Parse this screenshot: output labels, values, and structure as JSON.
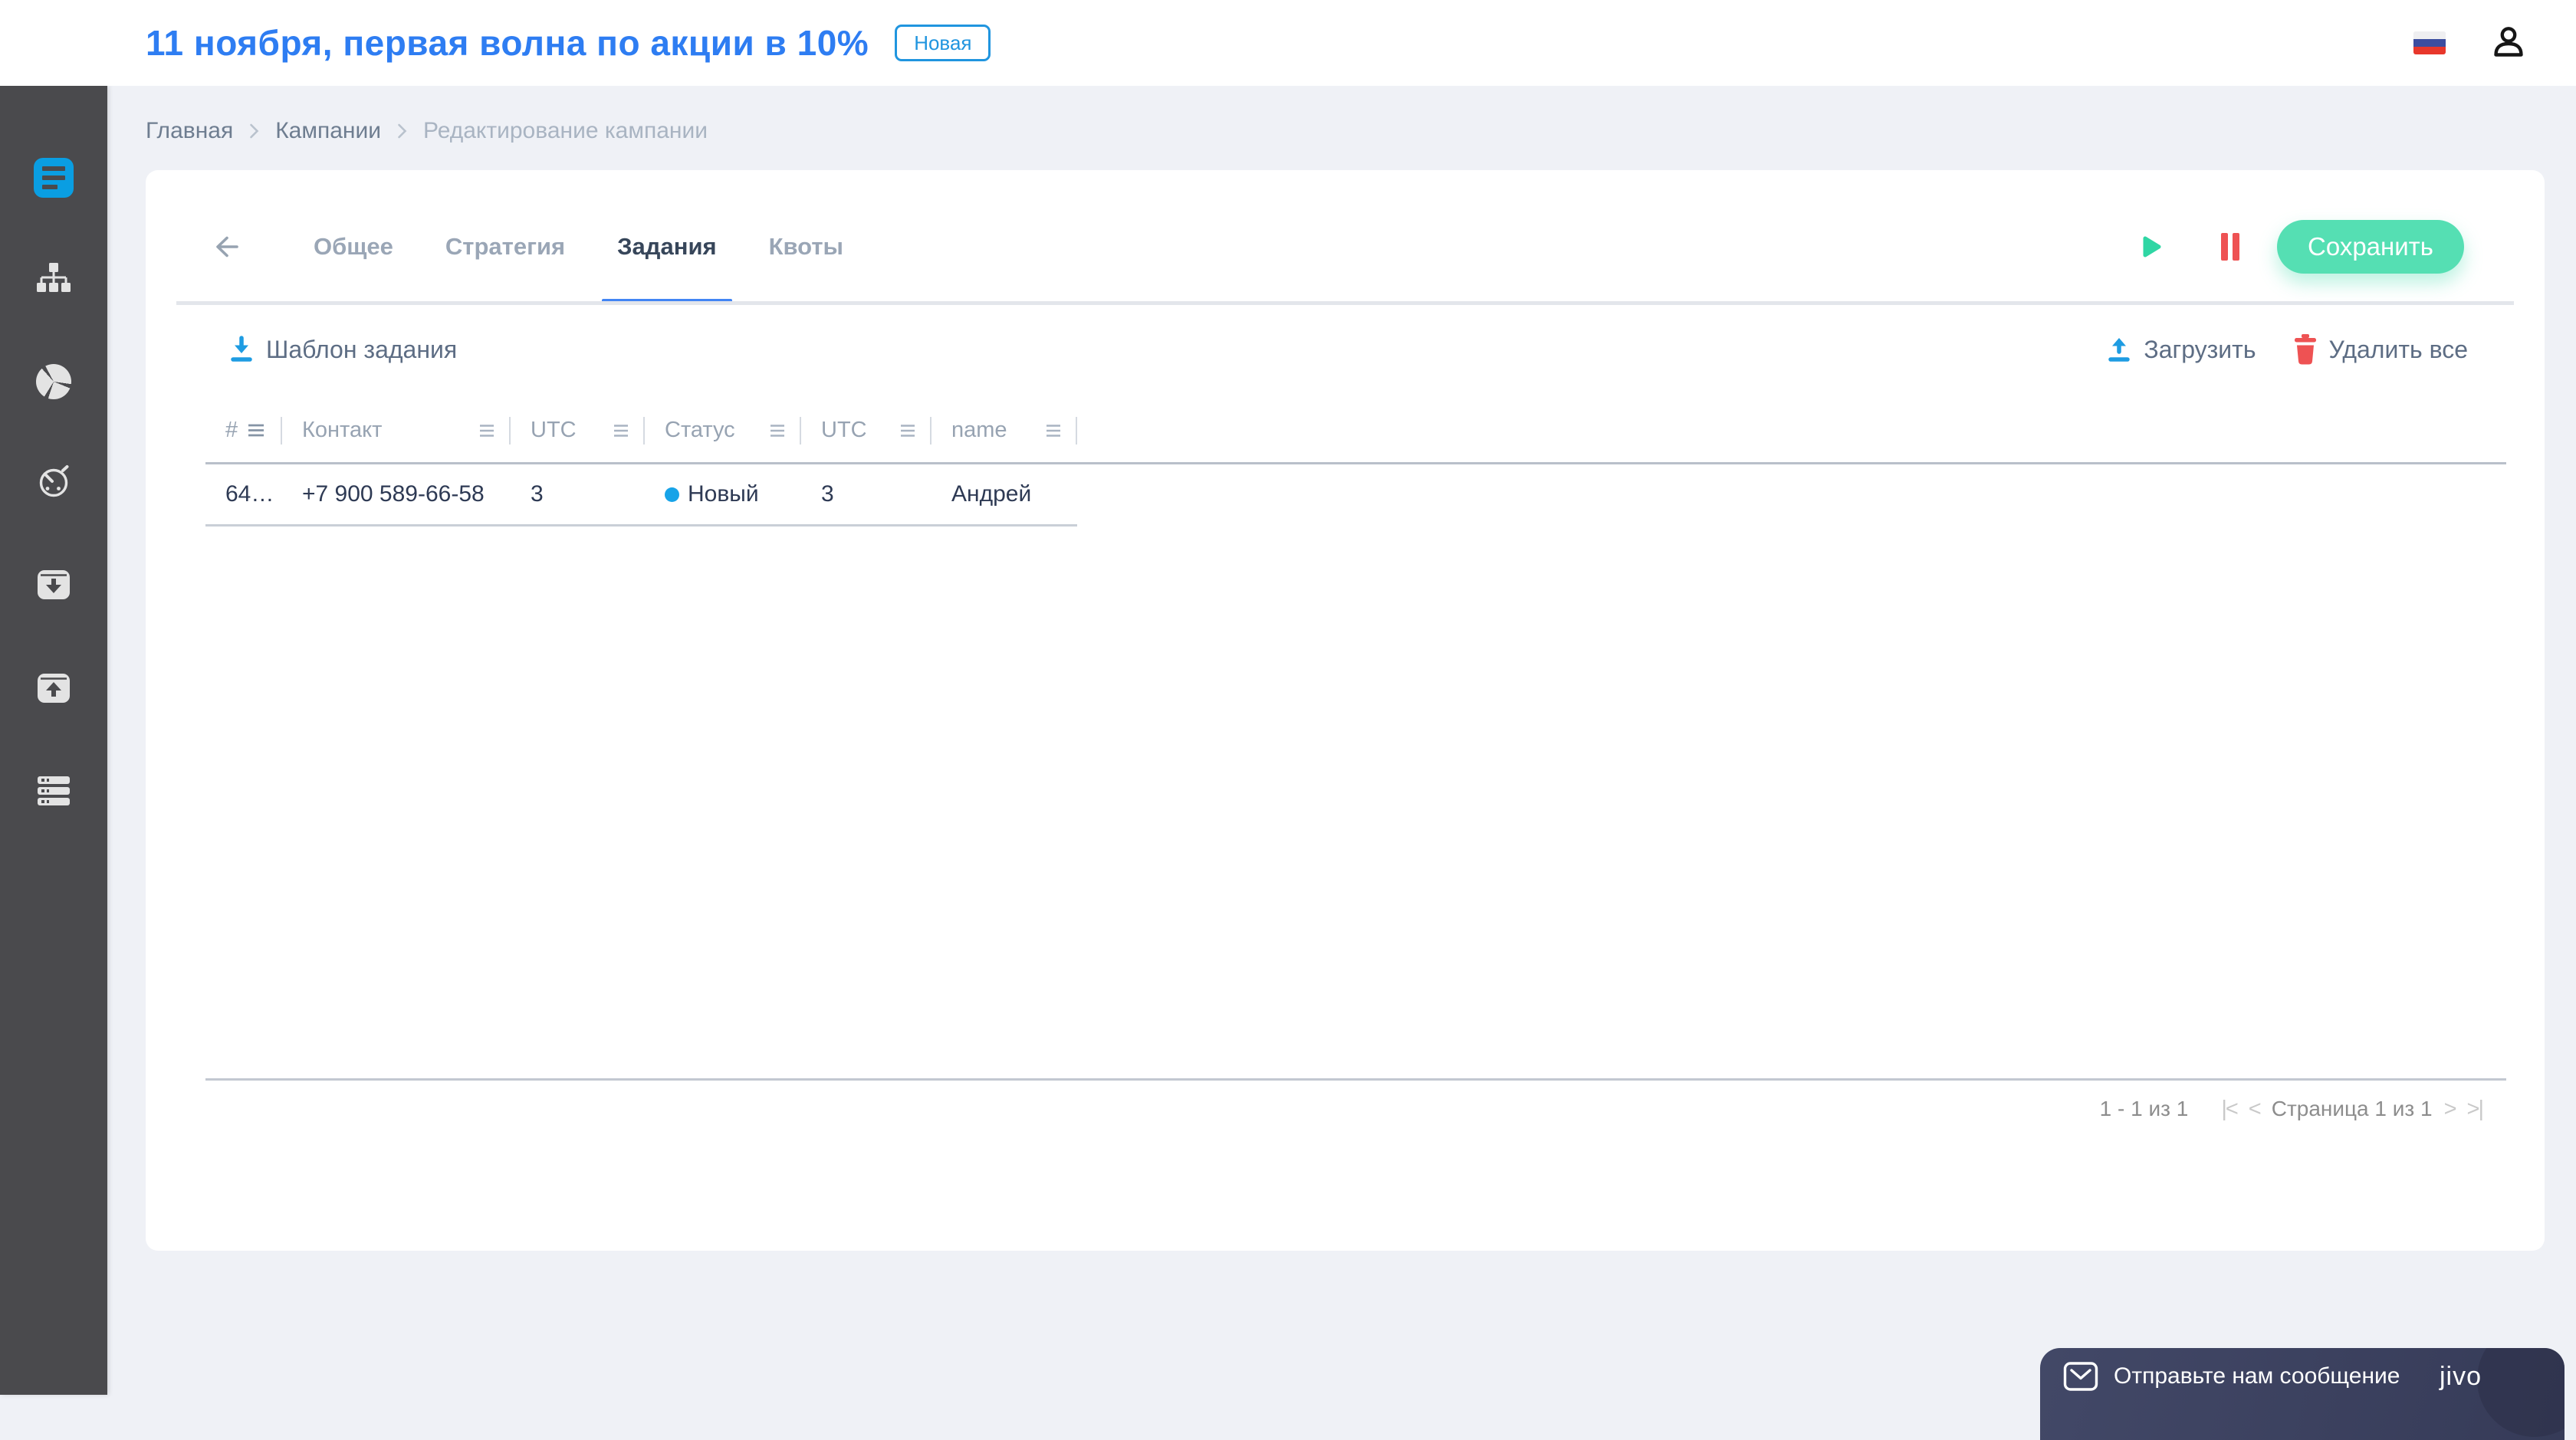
{
  "header": {
    "title": "11 ноября, первая волна по акции в 10%",
    "badge": "Новая",
    "flag_icon": "russian-flag",
    "user_icon": "user-profile"
  },
  "breadcrumb": {
    "items": [
      "Главная",
      "Кампании",
      "Редактирование кампании"
    ]
  },
  "sidebar": {
    "icons": [
      "campaigns-list",
      "sitemap",
      "pie-chart",
      "timer",
      "archive-in",
      "archive-out",
      "server-stack"
    ]
  },
  "tabs": {
    "items": [
      {
        "label": "Общее",
        "active": false
      },
      {
        "label": "Стратегия",
        "active": false
      },
      {
        "label": "Задания",
        "active": true
      },
      {
        "label": "Квоты",
        "active": false
      }
    ]
  },
  "actions": {
    "play_icon": "play",
    "pause_icon": "pause",
    "save_label": "Сохранить"
  },
  "toolbar": {
    "template_label": "Шаблон задания",
    "upload_label": "Загрузить",
    "delete_all_label": "Удалить все"
  },
  "table": {
    "columns": [
      "#",
      "Контакт",
      "UTC",
      "Статус",
      "UTC",
      "name"
    ],
    "rows": [
      {
        "id": "64…",
        "contact": "+7 900 589-66-58",
        "utc1": "3",
        "status": "Новый",
        "utc2": "3",
        "name": "Андрей"
      }
    ]
  },
  "pagination": {
    "range": "1 - 1 из 1",
    "first": "|<",
    "prev": "<",
    "page_label": "Страница 1 из 1",
    "next": ">",
    "last": ">|"
  },
  "chat": {
    "message": "Отправьте нам сообщение",
    "brand": "jivo"
  },
  "colors": {
    "accent_blue": "#2e7df2",
    "badge_blue": "#2095df",
    "link_icon_blue": "#1e9ce2",
    "tab_indicator": "#4285f4",
    "save_mint": "#55dfb3",
    "play_green": "#2fd6a4",
    "danger_red": "#ee5253",
    "status_dot_blue": "#17a3e8",
    "sidebar_bg": "#4a4a4d",
    "sidebar_active_blue": "#0a9ee2",
    "chat_bg": "#3a3f5e"
  }
}
